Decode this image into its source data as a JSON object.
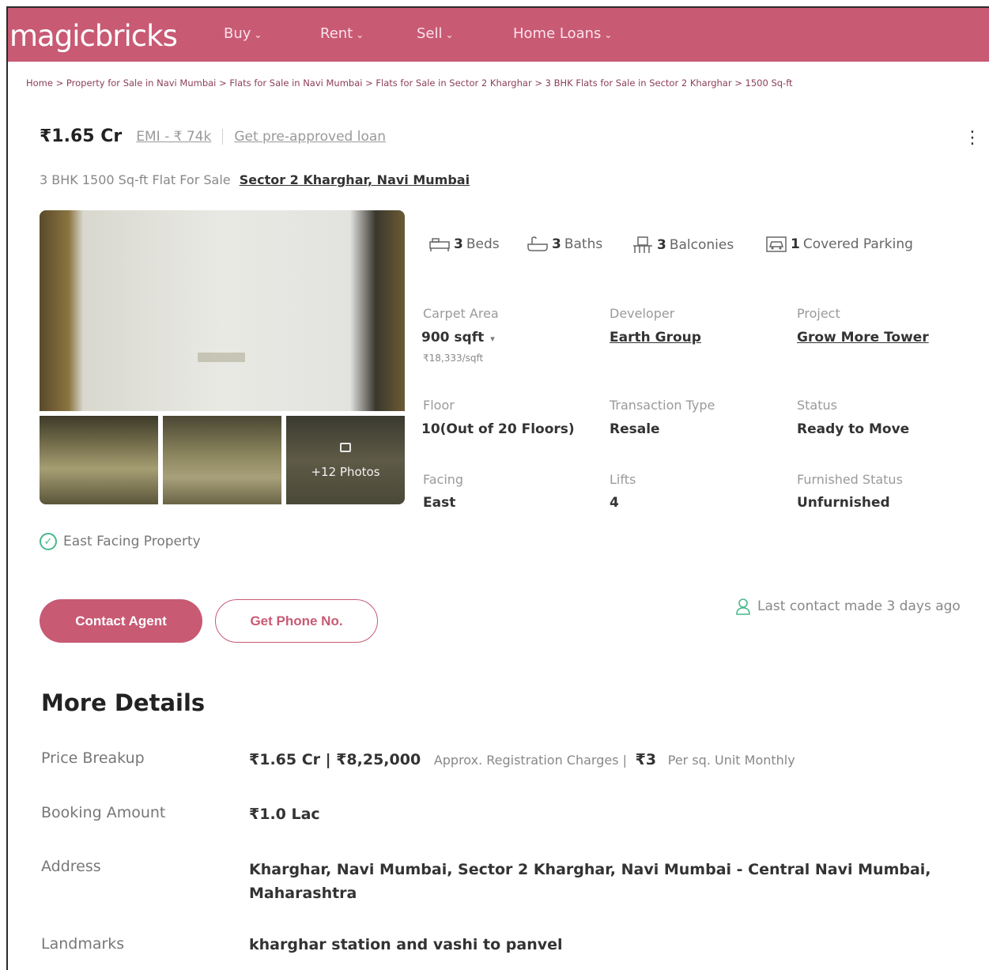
{
  "brand": {
    "logo": "magicbricks"
  },
  "nav": {
    "items": [
      {
        "label": "Buy"
      },
      {
        "label": "Rent"
      },
      {
        "label": "Sell"
      },
      {
        "label": "Home Loans"
      }
    ]
  },
  "breadcrumb": "Home > Property for Sale in Navi Mumbai > Flats for Sale in Navi Mumbai > Flats for Sale in Sector 2 Kharghar > 3 BHK Flats for Sale in Sector 2 Kharghar > 1500 Sq-ft",
  "listing": {
    "price": "₹1.65 Cr",
    "emi": "EMI - ₹ 74k",
    "loan_link": "Get pre-approved loan",
    "subtitle": "3 BHK 1500 Sq-ft Flat For Sale",
    "location": "Sector 2 Kharghar, Navi Mumbai",
    "more_photos": "+12 Photos"
  },
  "amenities": {
    "beds_num": "3",
    "beds_label": "Beds",
    "baths_num": "3",
    "baths_label": "Baths",
    "balconies_num": "3",
    "balconies_label": "Balconies",
    "parking_num": "1",
    "parking_label": "Covered Parking"
  },
  "specs": {
    "carpet_area_label": "Carpet Area",
    "carpet_area_value": "900 sqft",
    "carpet_area_rate": "₹18,333/sqft",
    "developer_label": "Developer",
    "developer_value": "Earth Group",
    "project_label": "Project",
    "project_value": "Grow More Tower",
    "floor_label": "Floor",
    "floor_value": "10(Out of 20 Floors)",
    "transaction_label": "Transaction Type",
    "transaction_value": "Resale",
    "status_label": "Status",
    "status_value": "Ready to Move",
    "facing_label": "Facing",
    "facing_value": "East",
    "lifts_label": "Lifts",
    "lifts_value": "4",
    "furnished_label": "Furnished Status",
    "furnished_value": "Unfurnished"
  },
  "highlight": "East Facing Property",
  "actions": {
    "contact_agent": "Contact Agent",
    "phone": "Get Phone No.",
    "last_contact": "Last contact made 3 days ago"
  },
  "more_details": {
    "title": "More Details",
    "price_breakup_label": "Price Breakup",
    "price_breakup_value": "₹1.65 Cr | ₹8,25,000",
    "price_breakup_note": "Approx. Registration Charges |",
    "price_breakup_maint": "₹3",
    "price_breakup_maint_note": "Per sq. Unit Monthly",
    "booking_label": "Booking Amount",
    "booking_value": "₹1.0 Lac",
    "address_label": "Address",
    "address_value": "Kharghar, Navi Mumbai, Sector 2 Kharghar, Navi Mumbai - Central Navi Mumbai, Maharashtra",
    "landmarks_label": "Landmarks",
    "landmarks_value": "kharghar station and vashi to panvel"
  },
  "colors": {
    "brand": "#c85a74",
    "success": "#47b88b"
  }
}
